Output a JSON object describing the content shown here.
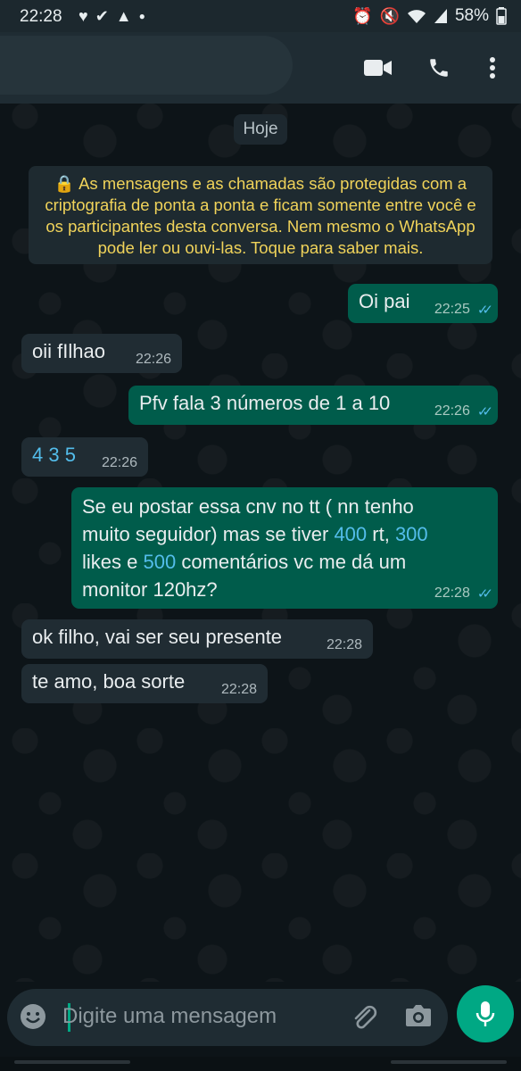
{
  "status_bar": {
    "time": "22:28",
    "battery": "58%",
    "left_icons": [
      "heart-icon",
      "download-done-icon",
      "warning-icon",
      "dot-icon"
    ],
    "right_icons": [
      "alarm-icon",
      "mute-icon",
      "wifi-icon",
      "signal-icon"
    ]
  },
  "header": {
    "actions": [
      "video-call-icon",
      "voice-call-icon",
      "more-options-icon"
    ]
  },
  "chat": {
    "date_chip": "Hoje",
    "encryption_notice": "🔒 As mensagens e as chamadas são protegidas com a criptografia de ponta a ponta e ficam somente entre você e os participantes desta conversa. Nem mesmo o WhatsApp pode ler ou ouvi-las. Toque para saber mais.",
    "messages": [
      {
        "direction": "out",
        "text": "Oi pai",
        "time": "22:25",
        "read": true
      },
      {
        "direction": "in",
        "text": "oii fIlhao",
        "time": "22:26"
      },
      {
        "direction": "out",
        "text": "Pfv fala 3 números de 1 a 10",
        "time": "22:26",
        "read": true
      },
      {
        "direction": "in",
        "text": "4 3 5",
        "time": "22:26"
      },
      {
        "direction": "out",
        "text_parts": {
          "line1": "Se eu postar essa cnv no tt ( nn tenho",
          "line2a": "muito seguidor) mas se tiver ",
          "n1": "400",
          "line2b": " rt, ",
          "n2": "300",
          "line3a": "likes e ",
          "n3": "500",
          "line3b": " comentários vc me dá um",
          "line4": "monitor 120hz?"
        },
        "time": "22:28",
        "read": true
      },
      {
        "direction": "in",
        "text": "ok filho, vai ser seu presente",
        "time": "22:28"
      },
      {
        "direction": "in",
        "text": "te amo, boa sorte",
        "time": "22:28"
      }
    ]
  },
  "input": {
    "placeholder": "Digite uma mensagem",
    "icons": [
      "emoji-icon",
      "attach-icon",
      "camera-icon",
      "microphone-icon"
    ]
  },
  "colors": {
    "accent": "#00a884",
    "outgoing_bubble": "#005c4b",
    "incoming_bubble": "#202c33",
    "read_ticks": "#53bdeb",
    "notice_text": "#f0d35a"
  }
}
